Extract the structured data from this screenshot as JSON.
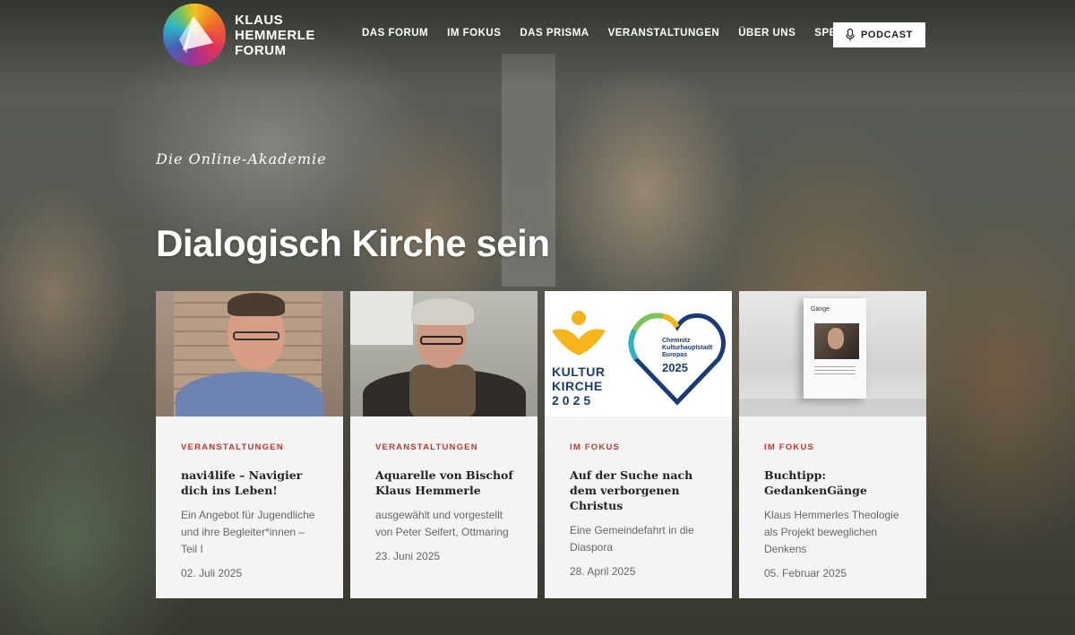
{
  "header": {
    "logo_lines": [
      "KLAUS",
      "HEMMERLE",
      "FORUM"
    ],
    "nav": [
      "DAS FORUM",
      "IM FOKUS",
      "DAS PRISMA",
      "VERANSTALTUNGEN",
      "ÜBER UNS",
      "SPENDE"
    ],
    "podcast_label": "PODCAST"
  },
  "hero": {
    "kicker": "Die Online-Akademie",
    "title": "Dialogisch Kirche sein"
  },
  "cards": [
    {
      "category": "VERANSTALTUNGEN",
      "title": "navi4life – Navigier dich ins Leben!",
      "description": "Ein Angebot für Jugendliche und ihre Begleiter*innen – Teil I",
      "date": "02. Juli 2025"
    },
    {
      "category": "VERANSTALTUNGEN",
      "title": "Aquarelle von Bischof Klaus Hemmerle",
      "description": "ausgewählt und vorgestellt von Peter Seifert, Ottmaring",
      "date": "23. Juni 2025"
    },
    {
      "category": "IM FOKUS",
      "title": "Auf der Suche nach dem verborgenen Christus",
      "description": "Eine Gemeindefahrt in die Diaspora",
      "date": "28. April 2025",
      "image_text": {
        "kultur_lines": [
          "KULTUR",
          "KIRCHE",
          "2025"
        ],
        "heart_lines": [
          "Chemnitz",
          "Kulturhauptstadt",
          "Europas"
        ],
        "heart_year": "2025"
      }
    },
    {
      "category": "IM FOKUS",
      "title": "Buchtipp: GedankenGänge",
      "description": "Klaus Hemmerles Theologie als Projekt beweglichen Denkens",
      "date": "05. Februar 2025",
      "image_text": {
        "book_title": "Gänge"
      }
    }
  ],
  "icons": {
    "logo": "prism-logo-icon",
    "podcast": "microphone-icon"
  },
  "colors": {
    "category": "#c0392b",
    "card_bg": "#f4f4f4",
    "heart_blue": "#1b3b78",
    "kk_yellow": "#f6b41d"
  }
}
